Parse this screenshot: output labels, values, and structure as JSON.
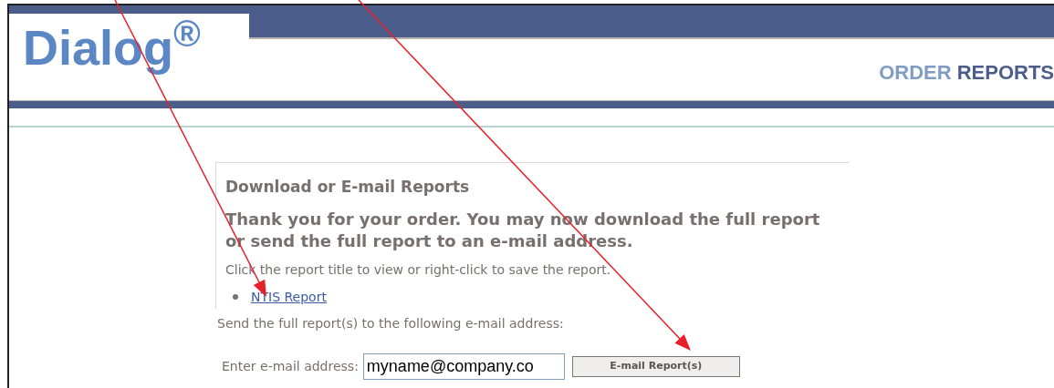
{
  "header": {
    "logo": "Dialog$^{®}$",
    "section_title": {
      "first": "ORDER",
      "second": "REPORTS"
    }
  },
  "panel": {
    "heading": "Download or E-mail Reports",
    "message": "Thank you for your order. You may now download the full report or send the full report to an e-mail address.",
    "instruction": "Click the report title to view or right-click to save the report.",
    "reports": [
      "NTIS Report"
    ]
  },
  "email": {
    "prompt": "Send the full report(s) to the following e-mail address:",
    "label": "Enter e-mail address:",
    "value": "myname@company.co",
    "button": "E-mail Report(s)"
  }
}
